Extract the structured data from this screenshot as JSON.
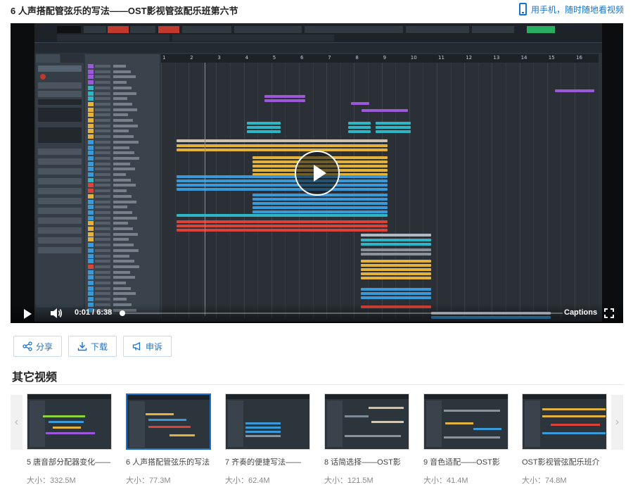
{
  "header": {
    "title": "6 人声搭配管弦乐的写法——OST影视管弦配乐班第六节",
    "mobile_link": "用手机，随时随地看视频"
  },
  "player": {
    "current_time": "0:01",
    "separator": "/",
    "duration": "6:38",
    "progress_fraction": 0.0025,
    "captions_label": "Captions",
    "ruler_numbers": [
      "1",
      "2",
      "3",
      "4",
      "5",
      "6",
      "7",
      "8",
      "9",
      "10",
      "11",
      "12",
      "13",
      "14",
      "15",
      "16"
    ]
  },
  "actions": {
    "share": "分享",
    "download": "下载",
    "report": "申诉"
  },
  "other_videos": {
    "title": "其它视频",
    "size_prefix": "大小：",
    "items": [
      {
        "title": "5 唐音部分配器变化——",
        "size": "332.5M",
        "active": false
      },
      {
        "title": "6 人声搭配管弦乐的写法",
        "size": "77.3M",
        "active": true
      },
      {
        "title": "7 齐奏的便捷写法——",
        "size": "62.4M",
        "active": false
      },
      {
        "title": "8 话简选择——OST影",
        "size": "121.5M",
        "active": false
      },
      {
        "title": "9 音色适配——OST影",
        "size": "41.4M",
        "active": false
      },
      {
        "title": "OST影视管弦配乐班介",
        "size": "74.8M",
        "active": false
      }
    ]
  },
  "colors": {
    "accent": "#1a73c9",
    "clip_purple": "#9b59d9",
    "clip_cyan": "#2fb6c4",
    "clip_yellow": "#e3b23c",
    "clip_blue": "#3a9ad9",
    "clip_red": "#d9433a"
  }
}
